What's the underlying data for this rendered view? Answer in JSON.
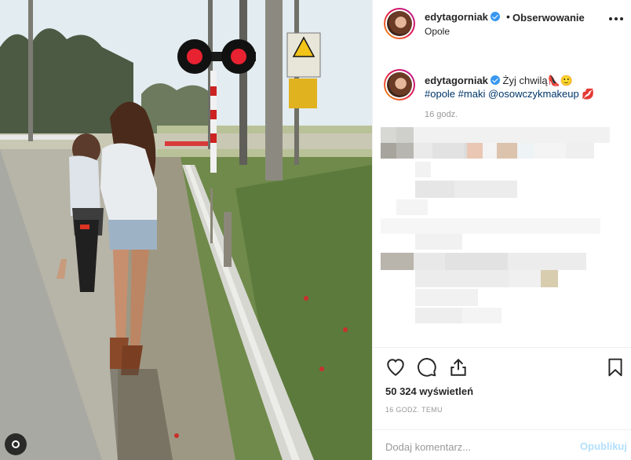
{
  "post": {
    "username": "edytagorniak",
    "follow_label": "Obserwowanie",
    "separator": "•",
    "location": "Opole",
    "more_icon": "more-horizontal-icon"
  },
  "caption": {
    "username": "edytagorniak",
    "text": "Żyj chwilą",
    "emojis": "👠🙂",
    "hashtags": "#opole #maki @osowczykmakeup",
    "lips_emoji": "💋",
    "time": "16 godz."
  },
  "actions": {
    "like_icon": "heart-icon",
    "comment_icon": "comment-icon",
    "share_icon": "share-icon",
    "save_icon": "bookmark-icon",
    "views": "50 324 wyświetleń",
    "posted_ago": "16 GODZ. TEMU"
  },
  "comment": {
    "placeholder": "Dodaj komentarz...",
    "publish_label": "Opublikuj"
  },
  "colors": {
    "link": "#003569",
    "verified": "#3897f0",
    "publish_disabled": "#b2dffc",
    "meta": "#999999"
  }
}
